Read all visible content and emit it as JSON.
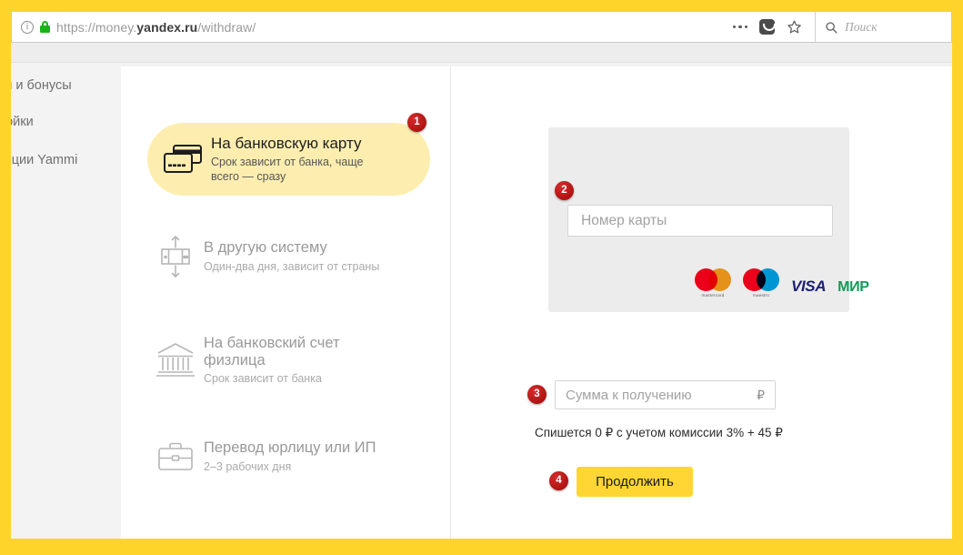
{
  "browser": {
    "url_prefix": "https://money.",
    "url_domain": "yandex.ru",
    "url_suffix": "/withdraw/",
    "info_glyph": "i",
    "search_placeholder": "Поиск"
  },
  "sidebar": {
    "items": [
      {
        "label": "си и бонусы"
      },
      {
        "label": "ройки"
      },
      {
        "label": "тиции Yammi"
      }
    ]
  },
  "methods": [
    {
      "title": "На банковскую карту",
      "subtitle_line1": "Срок зависит от банка, чаще",
      "subtitle_line2": "всего — сразу",
      "icon": "credit-card-icon",
      "badge": "1",
      "selected": true
    },
    {
      "title": "В другую систему",
      "subtitle_line1": "Один-два дня, зависит от страны",
      "subtitle_line2": "",
      "icon": "transfer-icon",
      "selected": false
    },
    {
      "title_line1": "На банковский счет",
      "title_line2": "физлица",
      "subtitle_line1": "Срок зависит от банка",
      "subtitle_line2": "",
      "icon": "bank-icon",
      "selected": false
    },
    {
      "title": "Перевод юрлицу или ИП",
      "subtitle_line1": "2–3 рабочих дня",
      "subtitle_line2": "",
      "icon": "briefcase-icon",
      "selected": false
    }
  ],
  "form": {
    "card_number_placeholder": "Номер карты",
    "card_badge": "2",
    "payment_systems": [
      {
        "name": "mastercard",
        "word": "mastercard",
        "color_left": "#eb001b",
        "color_right": "#f79e1b"
      },
      {
        "name": "maestro",
        "word": "maestro",
        "color_left": "#eb001b",
        "color_right": "#00a2e5"
      },
      {
        "name": "visa",
        "word": "VISA",
        "color": "#1a1f71"
      },
      {
        "name": "mir",
        "word": "МИР",
        "color": "#0f9d58"
      }
    ],
    "amount_badge": "3",
    "amount_placeholder": "Сумма к получению",
    "currency_symbol": "₽",
    "fee_note": "Спишется 0  ₽ с учетом комиссии 3% + 45 ₽",
    "continue_badge": "4",
    "continue_label": "Продолжить"
  },
  "colors": {
    "frame_yellow": "#ffd42a",
    "accent_yellow": "#ffd633",
    "selected_pill": "#fdeeb0",
    "badge_red": "#ad1212",
    "panel_gray": "#ececec"
  }
}
